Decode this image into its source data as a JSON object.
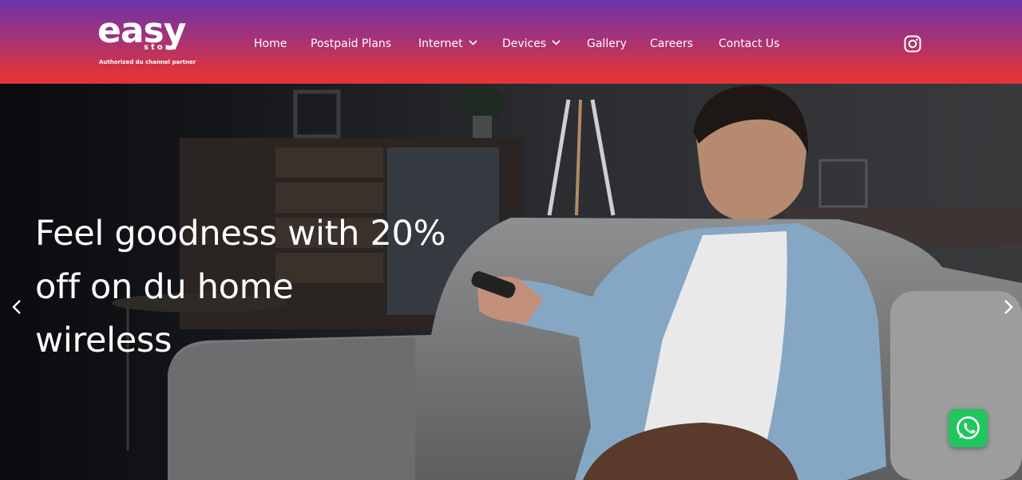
{
  "logo": {
    "word": "easy",
    "sub": "store",
    "tagline": "Authorized du channel partner"
  },
  "nav": {
    "items": [
      {
        "label": "Home",
        "dropdown": false
      },
      {
        "label": "Postpaid Plans",
        "dropdown": false
      },
      {
        "label": "Internet",
        "dropdown": true
      },
      {
        "label": "Devices",
        "dropdown": true
      },
      {
        "label": "Gallery",
        "dropdown": false
      },
      {
        "label": "Careers",
        "dropdown": false
      },
      {
        "label": "Contact Us",
        "dropdown": false
      }
    ]
  },
  "icons": {
    "social": "instagram-icon",
    "prev": "chevron-left-icon",
    "next": "chevron-right-icon",
    "chat": "whatsapp-icon"
  },
  "hero": {
    "lines": [
      "Feel goodness with 20%",
      "off on du home",
      "wireless"
    ]
  },
  "colors": {
    "header_top": "#6a33a8",
    "header_bottom": "#e23537",
    "whatsapp": "#22c55e",
    "text": "#ffffff"
  }
}
